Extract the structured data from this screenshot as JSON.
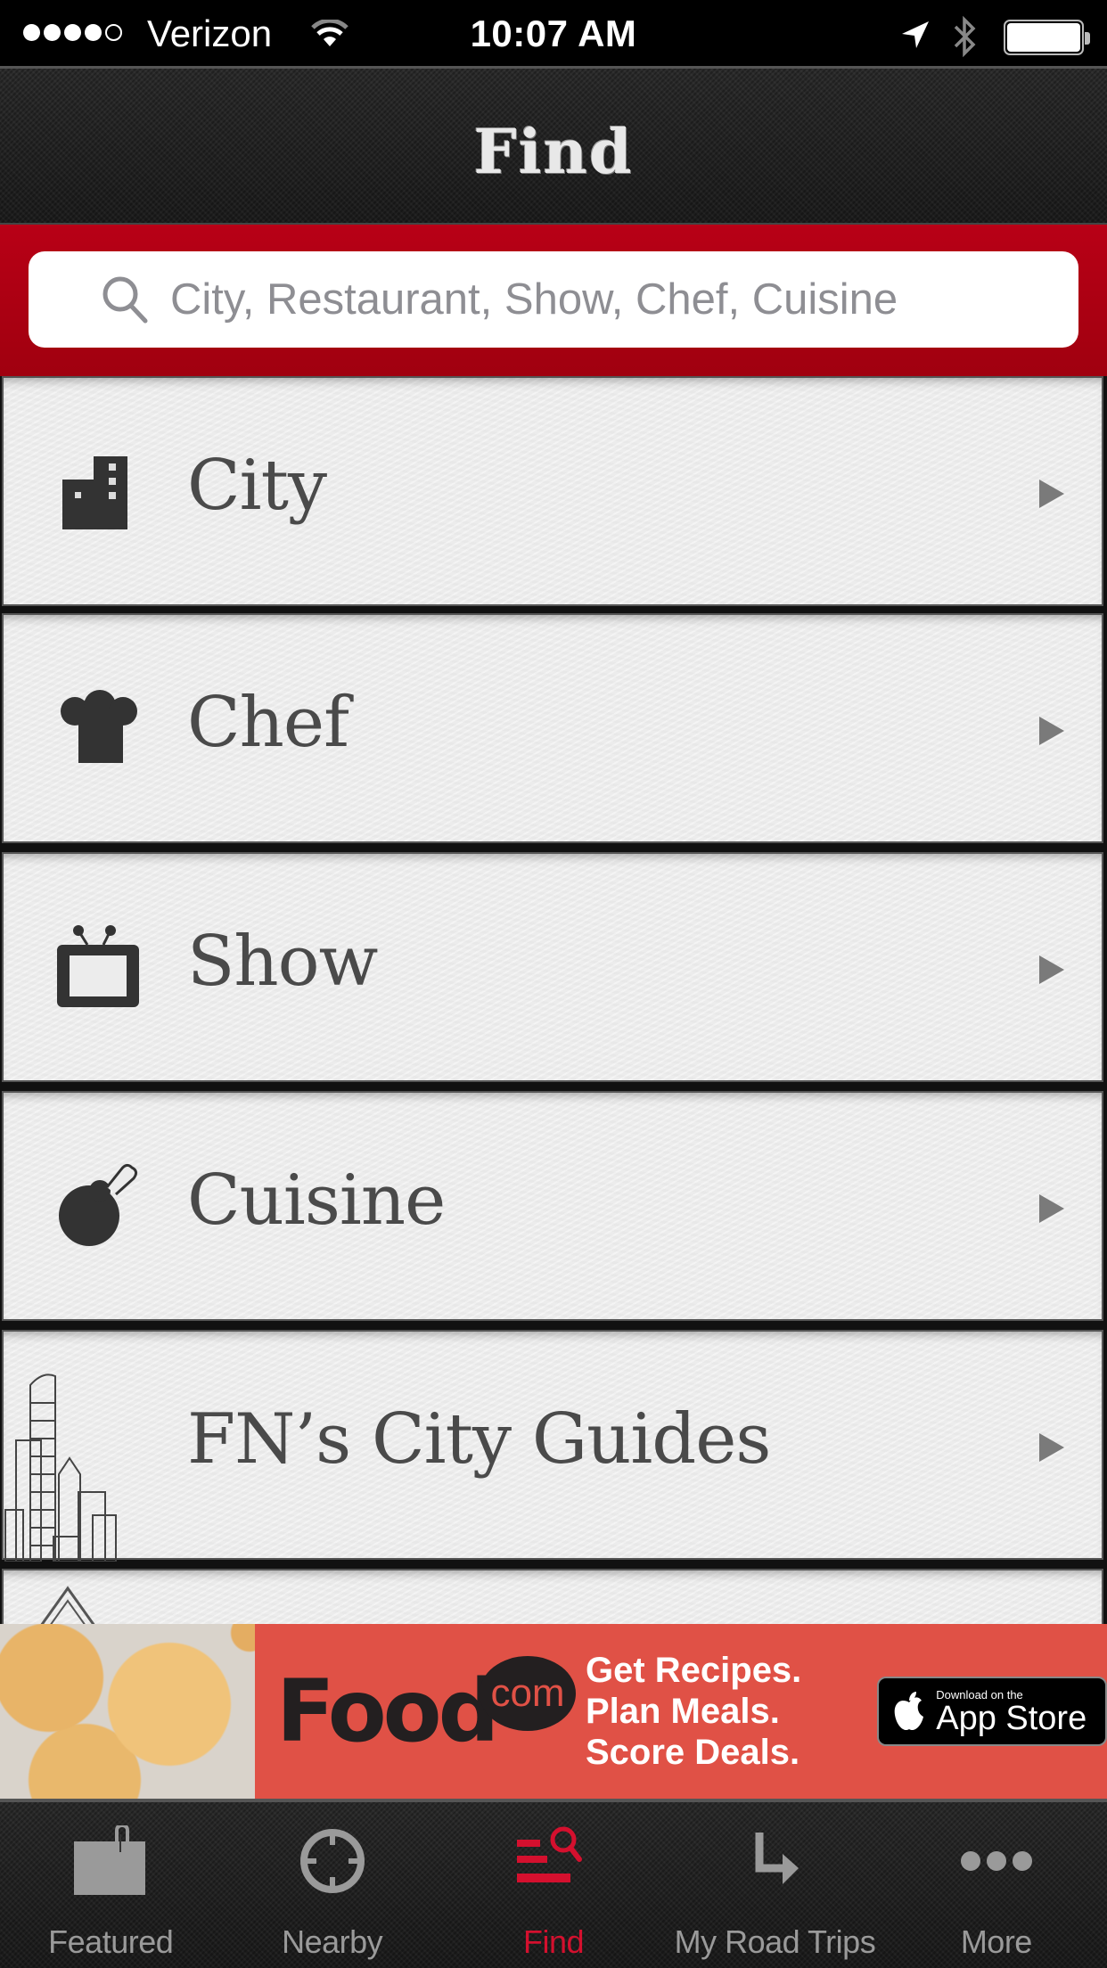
{
  "status_bar": {
    "signal_bars_filled": 4,
    "signal_bars_total": 5,
    "carrier": "Verizon",
    "time": "10:07 AM",
    "icons": [
      "wifi-icon",
      "location-arrow-icon",
      "bluetooth-icon",
      "battery-icon"
    ]
  },
  "nav": {
    "title": "Find"
  },
  "search": {
    "placeholder": "City, Restaurant, Show, Chef, Cuisine",
    "value": "",
    "icon": "search-icon"
  },
  "list": {
    "items": [
      {
        "label": "City",
        "icon": "city-buildings-icon"
      },
      {
        "label": "Chef",
        "icon": "chef-hat-icon"
      },
      {
        "label": "Show",
        "icon": "tv-icon"
      },
      {
        "label": "Cuisine",
        "icon": "drumstick-icon"
      },
      {
        "label": "FN’s City Guides",
        "icon": "city-skyline-icon"
      }
    ]
  },
  "ad": {
    "brand": "Food",
    "brand_suffix": "com",
    "tagline_lines": [
      "Get Recipes.",
      "Plan Meals.",
      "Score Deals."
    ],
    "badge_small": "Download on the",
    "badge_big": "App Store",
    "background_color": "#e05146"
  },
  "tab_bar": {
    "active_color": "#d4102e",
    "inactive_color": "#9a9a9a",
    "tabs": [
      {
        "label": "Featured",
        "icon": "clipboard-icon",
        "active": false
      },
      {
        "label": "Nearby",
        "icon": "crosshair-icon",
        "active": false
      },
      {
        "label": "Find",
        "icon": "find-list-search-icon",
        "active": true
      },
      {
        "label": "My Road Trips",
        "icon": "turn-arrow-icon",
        "active": false
      },
      {
        "label": "More",
        "icon": "more-dots-icon",
        "active": false
      }
    ]
  }
}
